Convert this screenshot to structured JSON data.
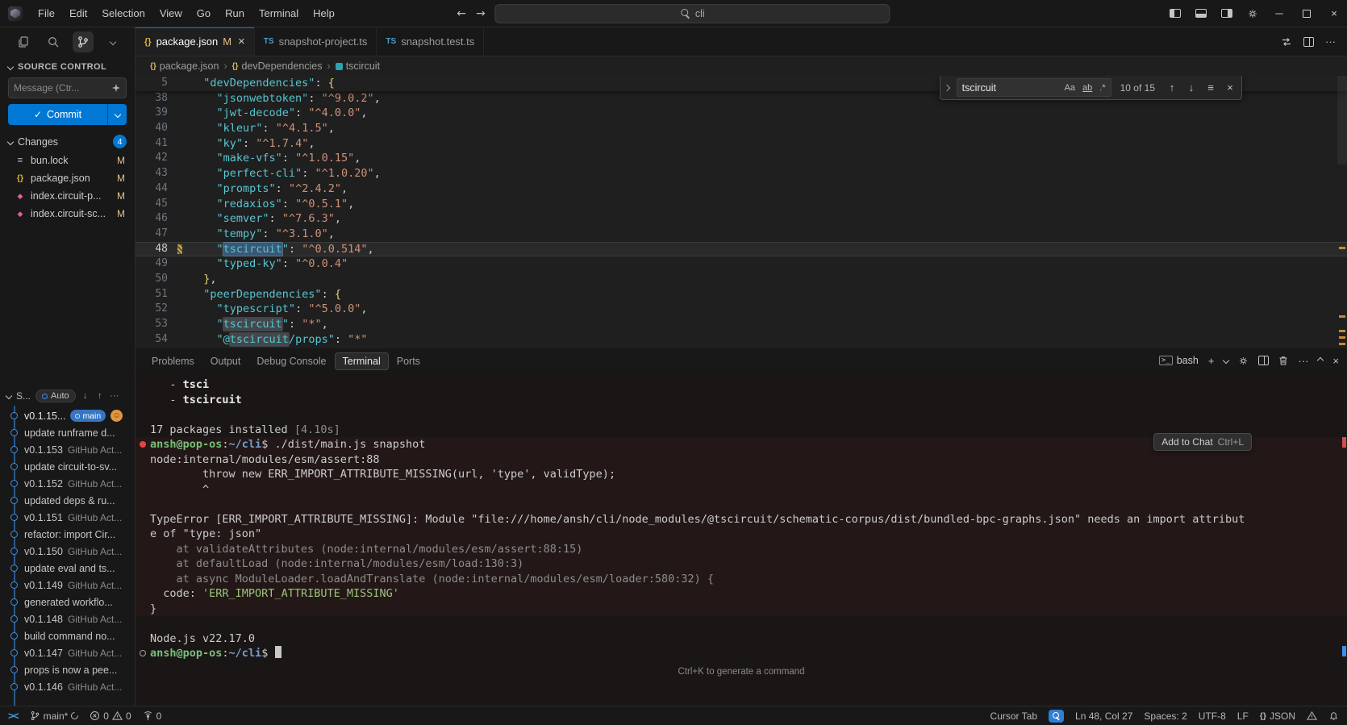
{
  "colors": {
    "accent": "#0078d4",
    "modified": "#e2c08d",
    "error": "#f14c4c",
    "json_key": "#58c6d2",
    "json_string": "#ce9178",
    "brace": "#eecf6d",
    "terminal_green": "#76c178",
    "terminal_blue": "#729fcf",
    "badge_blue": "#3575c2"
  },
  "titlebar": {
    "menus": [
      "File",
      "Edit",
      "Selection",
      "View",
      "Go",
      "Run",
      "Terminal",
      "Help"
    ],
    "search_text": "cli"
  },
  "sidebar": {
    "section_title": "SOURCE CONTROL",
    "message_placeholder": "Message (Ctr...",
    "commit_label": "Commit",
    "changes_label": "Changes",
    "changes_count": "4",
    "files": [
      {
        "name": "bun.lock",
        "icon": "bunlock",
        "glyph": "≡",
        "badge": "M"
      },
      {
        "name": "package.json",
        "icon": "json",
        "glyph": "{}",
        "badge": "M"
      },
      {
        "name": "index.circuit-p...",
        "icon": "circuit",
        "glyph": "◆",
        "badge": "M"
      },
      {
        "name": "index.circuit-sc...",
        "icon": "circuit",
        "glyph": "◆",
        "badge": "M"
      }
    ],
    "graph": {
      "header_label": "S...",
      "auto_label": "Auto",
      "items": [
        {
          "kind": "head",
          "label": "v0.1.15...",
          "badge": "main",
          "avatar": true
        },
        {
          "kind": "msg",
          "label": "update runframe d..."
        },
        {
          "kind": "ver",
          "label": "v0.1.153",
          "author": "GitHub Act..."
        },
        {
          "kind": "msg",
          "label": "update circuit-to-sv..."
        },
        {
          "kind": "ver",
          "label": "v0.1.152",
          "author": "GitHub Act..."
        },
        {
          "kind": "msg",
          "label": "updated deps & ru..."
        },
        {
          "kind": "ver",
          "label": "v0.1.151",
          "author": "GitHub Act..."
        },
        {
          "kind": "msg",
          "label": "refactor: import Cir..."
        },
        {
          "kind": "ver",
          "label": "v0.1.150",
          "author": "GitHub Act..."
        },
        {
          "kind": "msg",
          "label": "update eval and ts..."
        },
        {
          "kind": "ver",
          "label": "v0.1.149",
          "author": "GitHub Act..."
        },
        {
          "kind": "msg",
          "label": "generated workflo..."
        },
        {
          "kind": "ver",
          "label": "v0.1.148",
          "author": "GitHub Act..."
        },
        {
          "kind": "msg",
          "label": "build command no..."
        },
        {
          "kind": "ver",
          "label": "v0.1.147",
          "author": "GitHub Act..."
        },
        {
          "kind": "msg",
          "label": "props is now a pee..."
        },
        {
          "kind": "ver",
          "label": "v0.1.146",
          "author": "GitHub Act..."
        }
      ]
    }
  },
  "editor": {
    "tabs": [
      {
        "label": "package.json",
        "icon": "braces",
        "modified": "M",
        "active": true
      },
      {
        "label": "snapshot-project.ts",
        "icon": "ts"
      },
      {
        "label": "snapshot.test.ts",
        "icon": "ts"
      }
    ],
    "breadcrumbs": [
      {
        "label": "package.json",
        "icon": "braces"
      },
      {
        "label": "devDependencies",
        "icon": "braces"
      },
      {
        "label": "tscircuit",
        "icon": "field"
      }
    ],
    "find": {
      "query": "tscircuit",
      "case_label": "Aa",
      "word_label": "ab",
      "regex_label": ".*",
      "results": "10 of 15"
    },
    "sticky_line": {
      "num": "5",
      "segs": [
        {
          "t": "  ",
          "c": ""
        },
        {
          "t": "\"devDependencies\"",
          "c": "k"
        },
        {
          "t": ": ",
          "c": "p"
        },
        {
          "t": "{",
          "c": "b"
        }
      ]
    },
    "lines": [
      {
        "num": "38",
        "segs": [
          {
            "t": "    ",
            "c": ""
          },
          {
            "t": "\"jsonwebtoken\"",
            "c": "k"
          },
          {
            "t": ": ",
            "c": "p"
          },
          {
            "t": "\"^9.0.2\"",
            "c": "s"
          },
          {
            "t": ",",
            "c": "p"
          }
        ]
      },
      {
        "num": "39",
        "segs": [
          {
            "t": "    ",
            "c": ""
          },
          {
            "t": "\"jwt-decode\"",
            "c": "k"
          },
          {
            "t": ": ",
            "c": "p"
          },
          {
            "t": "\"^4.0.0\"",
            "c": "s"
          },
          {
            "t": ",",
            "c": "p"
          }
        ]
      },
      {
        "num": "40",
        "segs": [
          {
            "t": "    ",
            "c": ""
          },
          {
            "t": "\"kleur\"",
            "c": "k"
          },
          {
            "t": ": ",
            "c": "p"
          },
          {
            "t": "\"^4.1.5\"",
            "c": "s"
          },
          {
            "t": ",",
            "c": "p"
          }
        ]
      },
      {
        "num": "41",
        "segs": [
          {
            "t": "    ",
            "c": ""
          },
          {
            "t": "\"ky\"",
            "c": "k"
          },
          {
            "t": ": ",
            "c": "p"
          },
          {
            "t": "\"^1.7.4\"",
            "c": "s"
          },
          {
            "t": ",",
            "c": "p"
          }
        ]
      },
      {
        "num": "42",
        "segs": [
          {
            "t": "    ",
            "c": ""
          },
          {
            "t": "\"make-vfs\"",
            "c": "k"
          },
          {
            "t": ": ",
            "c": "p"
          },
          {
            "t": "\"^1.0.15\"",
            "c": "s"
          },
          {
            "t": ",",
            "c": "p"
          }
        ]
      },
      {
        "num": "43",
        "segs": [
          {
            "t": "    ",
            "c": ""
          },
          {
            "t": "\"perfect-cli\"",
            "c": "k"
          },
          {
            "t": ": ",
            "c": "p"
          },
          {
            "t": "\"^1.0.20\"",
            "c": "s"
          },
          {
            "t": ",",
            "c": "p"
          }
        ]
      },
      {
        "num": "44",
        "segs": [
          {
            "t": "    ",
            "c": ""
          },
          {
            "t": "\"prompts\"",
            "c": "k"
          },
          {
            "t": ": ",
            "c": "p"
          },
          {
            "t": "\"^2.4.2\"",
            "c": "s"
          },
          {
            "t": ",",
            "c": "p"
          }
        ]
      },
      {
        "num": "45",
        "segs": [
          {
            "t": "    ",
            "c": ""
          },
          {
            "t": "\"redaxios\"",
            "c": "k"
          },
          {
            "t": ": ",
            "c": "p"
          },
          {
            "t": "\"^0.5.1\"",
            "c": "s"
          },
          {
            "t": ",",
            "c": "p"
          }
        ]
      },
      {
        "num": "46",
        "segs": [
          {
            "t": "    ",
            "c": ""
          },
          {
            "t": "\"semver\"",
            "c": "k"
          },
          {
            "t": ": ",
            "c": "p"
          },
          {
            "t": "\"^7.6.3\"",
            "c": "s"
          },
          {
            "t": ",",
            "c": "p"
          }
        ]
      },
      {
        "num": "47",
        "segs": [
          {
            "t": "    ",
            "c": ""
          },
          {
            "t": "\"tempy\"",
            "c": "k"
          },
          {
            "t": ": ",
            "c": "p"
          },
          {
            "t": "\"^3.1.0\"",
            "c": "s"
          },
          {
            "t": ",",
            "c": "p"
          }
        ]
      },
      {
        "num": "48",
        "current": true,
        "marker": true,
        "segs": [
          {
            "t": "    ",
            "c": ""
          },
          {
            "t": "\"",
            "c": "k"
          },
          {
            "t": "tscircuit",
            "c": "k mc"
          },
          {
            "t": "\"",
            "c": "k"
          },
          {
            "t": ": ",
            "c": "p"
          },
          {
            "t": "\"^0.0.514\"",
            "c": "s"
          },
          {
            "t": ",",
            "c": "p"
          }
        ]
      },
      {
        "num": "49",
        "segs": [
          {
            "t": "    ",
            "c": ""
          },
          {
            "t": "\"typed-ky\"",
            "c": "k"
          },
          {
            "t": ": ",
            "c": "p"
          },
          {
            "t": "\"^0.0.4\"",
            "c": "s"
          }
        ]
      },
      {
        "num": "50",
        "segs": [
          {
            "t": "  ",
            "c": ""
          },
          {
            "t": "}",
            "c": "b"
          },
          {
            "t": ",",
            "c": "p"
          }
        ]
      },
      {
        "num": "51",
        "segs": [
          {
            "t": "  ",
            "c": ""
          },
          {
            "t": "\"peerDependencies\"",
            "c": "k"
          },
          {
            "t": ": ",
            "c": "p"
          },
          {
            "t": "{",
            "c": "b"
          }
        ]
      },
      {
        "num": "52",
        "segs": [
          {
            "t": "    ",
            "c": ""
          },
          {
            "t": "\"typescript\"",
            "c": "k"
          },
          {
            "t": ": ",
            "c": "p"
          },
          {
            "t": "\"^5.0.0\"",
            "c": "s"
          },
          {
            "t": ",",
            "c": "p"
          }
        ]
      },
      {
        "num": "53",
        "segs": [
          {
            "t": "    ",
            "c": ""
          },
          {
            "t": "\"",
            "c": "k"
          },
          {
            "t": "tscircuit",
            "c": "k m"
          },
          {
            "t": "\"",
            "c": "k"
          },
          {
            "t": ": ",
            "c": "p"
          },
          {
            "t": "\"*\"",
            "c": "s"
          },
          {
            "t": ",",
            "c": "p"
          }
        ]
      },
      {
        "num": "54",
        "segs": [
          {
            "t": "    ",
            "c": ""
          },
          {
            "t": "\"@",
            "c": "k"
          },
          {
            "t": "tscircuit",
            "c": "k m"
          },
          {
            "t": "/props\"",
            "c": "k"
          },
          {
            "t": ": ",
            "c": "p"
          },
          {
            "t": "\"*\"",
            "c": "s"
          }
        ]
      }
    ]
  },
  "panel": {
    "tabs": [
      "Problems",
      "Output",
      "Debug Console",
      "Terminal",
      "Ports"
    ],
    "active_tab": "Terminal",
    "shell_label": "bash",
    "hint": "Ctrl+K to generate a command",
    "tooltip": {
      "label": "Add to Chat",
      "shortcut": "Ctrl+L"
    },
    "terminal_lines": [
      {
        "segs": [
          {
            "t": "   - ",
            "c": "w"
          },
          {
            "t": "tsci",
            "c": "wb"
          }
        ]
      },
      {
        "segs": [
          {
            "t": "   - ",
            "c": "w"
          },
          {
            "t": "tscircuit",
            "c": "wb"
          }
        ]
      },
      {
        "segs": []
      },
      {
        "segs": [
          {
            "t": "17 packages installed ",
            "c": "w"
          },
          {
            "t": "[4.10s]",
            "c": "dim"
          }
        ]
      },
      {
        "deco": "error",
        "tint": true,
        "segs": [
          {
            "t": "ansh@pop-os",
            "c": "g"
          },
          {
            "t": ":",
            "c": "w"
          },
          {
            "t": "~/cli",
            "c": "bl"
          },
          {
            "t": "$ ./dist/main.js snapshot",
            "c": "w"
          }
        ]
      },
      {
        "tint": true,
        "segs": [
          {
            "t": "node:internal/modules/esm/assert:88",
            "c": "w"
          }
        ]
      },
      {
        "tint": true,
        "segs": [
          {
            "t": "        throw new ERR_IMPORT_ATTRIBUTE_MISSING(url, 'type', validType);",
            "c": "w"
          }
        ]
      },
      {
        "tint": true,
        "segs": [
          {
            "t": "        ^",
            "c": "w"
          }
        ]
      },
      {
        "tint": true,
        "segs": []
      },
      {
        "tint": true,
        "segs": [
          {
            "t": "TypeError [ERR_IMPORT_ATTRIBUTE_MISSING]: Module \"file:///home/ansh/cli/node_modules/@tscircuit/schematic-corpus/dist/bundled-bpc-graphs.json\" needs an import attribut",
            "c": "w"
          }
        ]
      },
      {
        "tint": true,
        "segs": [
          {
            "t": "e of \"type: json\"",
            "c": "w"
          }
        ]
      },
      {
        "tint": true,
        "segs": [
          {
            "t": "    at validateAttributes (node:internal/modules/esm/assert:88:15)",
            "c": "dim"
          }
        ]
      },
      {
        "tint": true,
        "segs": [
          {
            "t": "    at defaultLoad (node:internal/modules/esm/load:130:3)",
            "c": "dim"
          }
        ]
      },
      {
        "tint": true,
        "segs": [
          {
            "t": "    at async ModuleLoader.loadAndTranslate (node:internal/modules/esm/loader:580:32) {",
            "c": "dim"
          }
        ]
      },
      {
        "tint": true,
        "segs": [
          {
            "t": "  code: ",
            "c": "w"
          },
          {
            "t": "'ERR_IMPORT_ATTRIBUTE_MISSING'",
            "c": "str"
          }
        ]
      },
      {
        "tint": true,
        "segs": [
          {
            "t": "}",
            "c": "w"
          }
        ]
      },
      {
        "segs": []
      },
      {
        "segs": [
          {
            "t": "Node.js v22.17.0",
            "c": "w"
          }
        ]
      },
      {
        "deco": "prompt",
        "cursor": true,
        "segs": [
          {
            "t": "ansh@pop-os",
            "c": "g"
          },
          {
            "t": ":",
            "c": "w"
          },
          {
            "t": "~/cli",
            "c": "bl"
          },
          {
            "t": "$ ",
            "c": "w"
          }
        ]
      }
    ]
  },
  "statusbar": {
    "branch": "main*",
    "errors": "0",
    "warnings": "0",
    "ports": "0",
    "cursor_tab": "Cursor Tab",
    "position": "Ln 48, Col 27",
    "indent": "Spaces: 2",
    "encoding": "UTF-8",
    "eol": "LF",
    "language": "JSON",
    "language_icon": "{}"
  }
}
